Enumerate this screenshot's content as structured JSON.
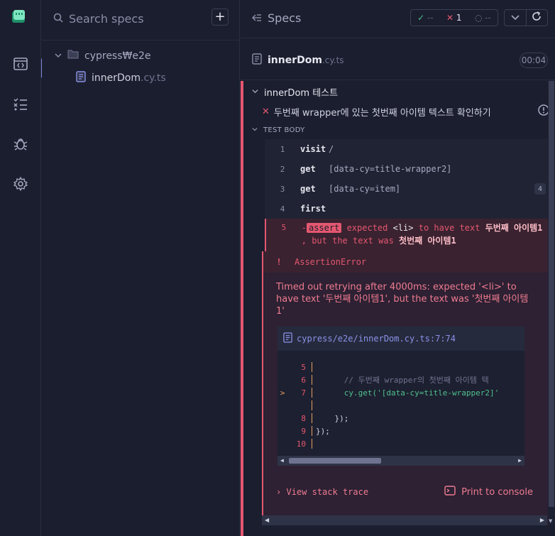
{
  "colors": {
    "accent": "#7f86d9",
    "fail": "#e45770",
    "pass": "#4fc08d",
    "background": "#1b1e2e"
  },
  "sidebar": {
    "items": [
      {
        "icon": "specs-icon"
      },
      {
        "icon": "runs-icon"
      },
      {
        "icon": "debug-icon"
      },
      {
        "icon": "settings-icon"
      }
    ]
  },
  "spec_list": {
    "search_placeholder": "Search specs",
    "folder": "cypress₩e2e",
    "file_name": "innerDom",
    "file_ext": ".cy.ts"
  },
  "reporter": {
    "title": "Specs",
    "stats": {
      "passed_icon": "✓",
      "passed": "--",
      "failed_icon": "✕",
      "failed": "1",
      "pending_icon": "◌",
      "pending": "--"
    },
    "spec_name": "innerDom",
    "spec_ext": ".cy.ts",
    "duration": "00:04",
    "suite_title": "innerDom 테스트",
    "test_title": "두번째 wrapper에 있는 첫번째 아이템 텍스트 확인하기",
    "body_label": "TEST BODY",
    "commands": [
      {
        "num": "1",
        "name": "visit",
        "arg": "/"
      },
      {
        "num": "2",
        "name": "get",
        "arg": "[data-cy=title-wrapper2]"
      },
      {
        "num": "3",
        "name": "get",
        "arg": "[data-cy=item]",
        "badge": "4"
      },
      {
        "num": "4",
        "name": "first",
        "arg": ""
      }
    ],
    "failed_command": {
      "num": "5",
      "prefix": "-",
      "tag": "assert",
      "text1": "expected",
      "subject": "<li>",
      "text2": "to have text",
      "expected": "두번째 아이템1",
      "text3": ", but the text was",
      "actual": "첫번째 아이템1"
    },
    "error": {
      "bang": "!",
      "name": "AssertionError",
      "message": "Timed out retrying after 4000ms: expected '<li>' to have text '두번째 아이템1', but the text was '첫번째 아이템1'",
      "file_path": "cypress/e2e/innerDom.cy.ts:7:74",
      "code_lines": [
        {
          "num": "5",
          "src": "",
          "ptr": ""
        },
        {
          "num": "6",
          "src": "      // 두번째 wrapper의 첫번째 아이템 텍",
          "ptr": ""
        },
        {
          "num": "7",
          "src": "      cy.get('[data-cy=title-wrapper2]'",
          "ptr": ">"
        },
        {
          "num": "",
          "src": "",
          "ptr": ""
        },
        {
          "num": "8",
          "src": "    });",
          "ptr": ""
        },
        {
          "num": "9",
          "src": "});",
          "ptr": ""
        },
        {
          "num": "10",
          "src": "",
          "ptr": ""
        }
      ],
      "stack_label": "View stack trace",
      "console_label": "Print to console"
    }
  }
}
